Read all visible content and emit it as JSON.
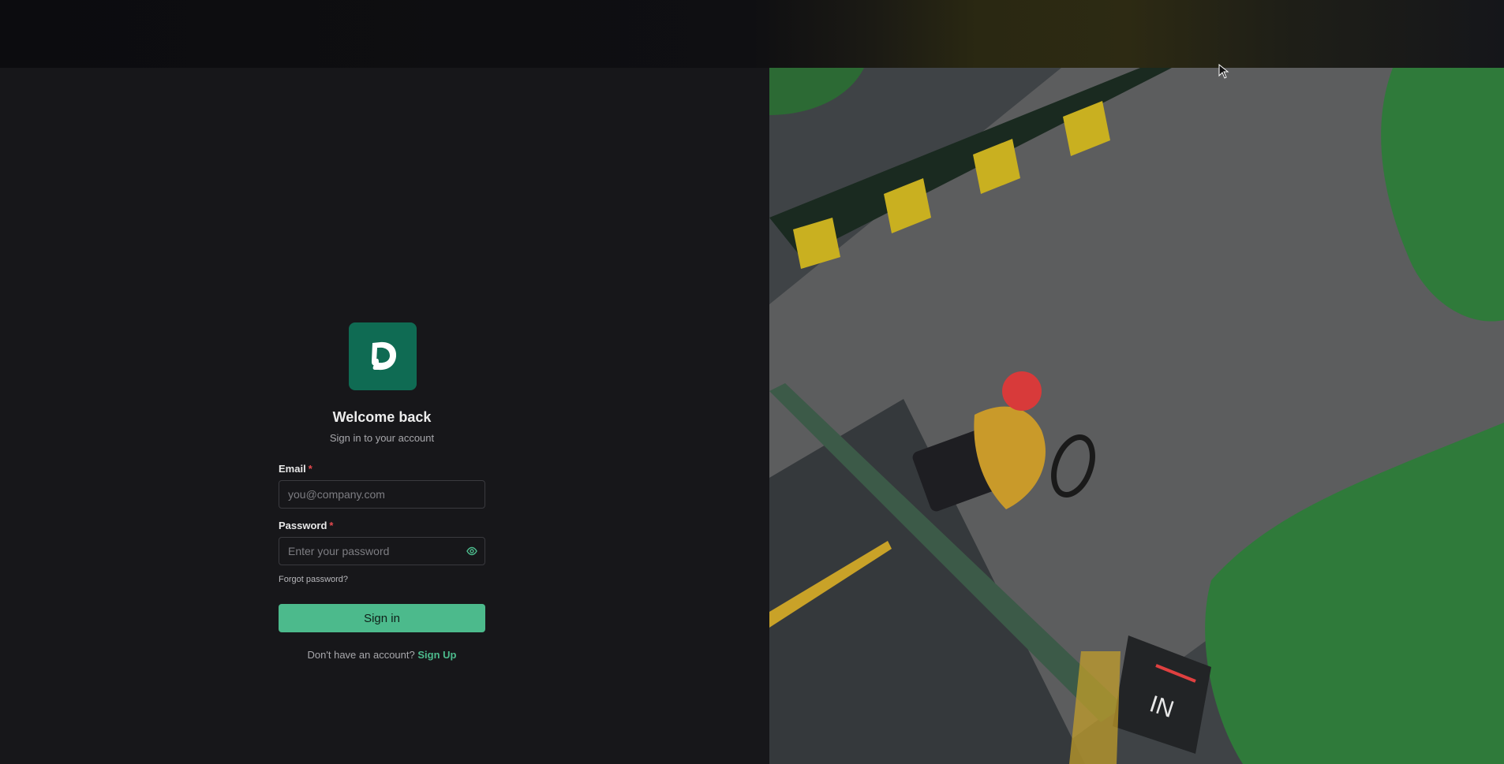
{
  "brand": {
    "logo_letter": "D",
    "accent": "#4cba8c",
    "logo_bg": "#0f6b53"
  },
  "login": {
    "title": "Welcome back",
    "subtitle": "Sign in to your account",
    "email_label": "Email",
    "email_placeholder": "you@company.com",
    "password_label": "Password",
    "password_placeholder": "Enter your password",
    "required_mark": "*",
    "forgot_password": "Forgot password?",
    "sign_in_button": "Sign in",
    "no_account_text": "Don't have an account?",
    "sign_up_link": "Sign Up"
  },
  "hero_image": {
    "sign_text": "IN"
  }
}
